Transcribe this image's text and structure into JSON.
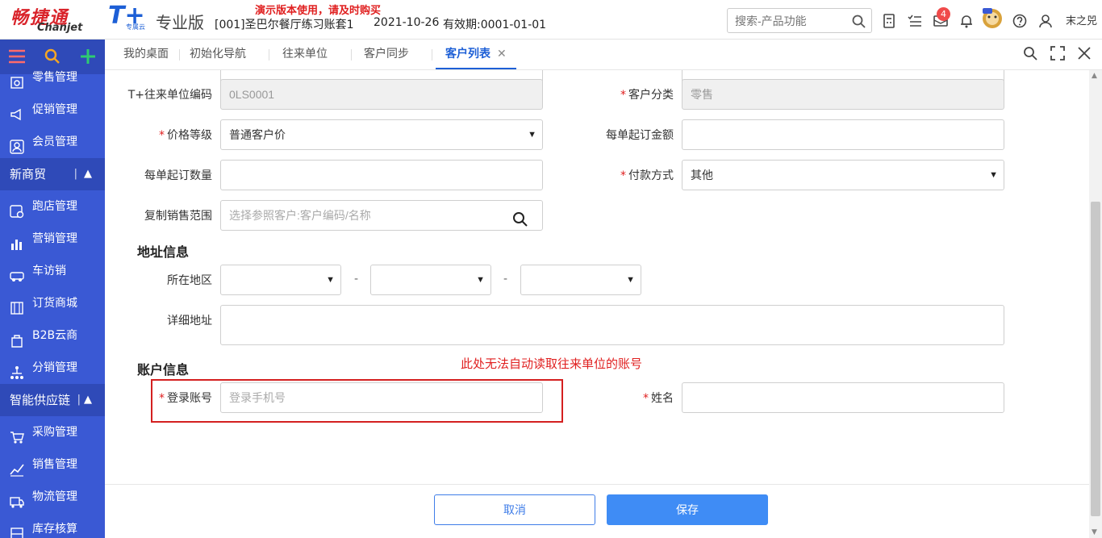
{
  "header": {
    "logo_cn": "畅捷通",
    "logo_en": "Chanjet",
    "product_logo": "T+",
    "product_sub": "专属云",
    "edition": "专业版",
    "demo_warning": "演示版本使用，请及时购买",
    "account": "[001]圣巴尔餐厅练习账套1",
    "date": "2021-10-26",
    "validity": "有效期:0001-01-01",
    "search_placeholder": "搜索-产品功能",
    "notification_count": "4",
    "user_name": "末之兕"
  },
  "sidebar": {
    "items_top": [
      {
        "label": "零售管理",
        "icon": "retail-icon"
      },
      {
        "label": "促销管理",
        "icon": "promotion-icon"
      },
      {
        "label": "会员管理",
        "icon": "member-icon"
      }
    ],
    "group1": "新商贸",
    "items_mid": [
      {
        "label": "跑店管理",
        "icon": "store-visit-icon"
      },
      {
        "label": "营销管理",
        "icon": "marketing-icon"
      },
      {
        "label": "车访销",
        "icon": "car-sales-icon"
      },
      {
        "label": "订货商城",
        "icon": "order-mall-icon"
      },
      {
        "label": "B2B云商",
        "icon": "b2b-icon"
      },
      {
        "label": "分销管理",
        "icon": "distribution-icon"
      }
    ],
    "group2": "智能供应链",
    "items_bottom": [
      {
        "label": "采购管理",
        "icon": "purchase-icon"
      },
      {
        "label": "销售管理",
        "icon": "sales-icon"
      },
      {
        "label": "物流管理",
        "icon": "logistics-icon"
      },
      {
        "label": "库存核算",
        "icon": "inventory-icon"
      }
    ]
  },
  "tabs": [
    {
      "label": "我的桌面"
    },
    {
      "label": "初始化导航"
    },
    {
      "label": "往来单位"
    },
    {
      "label": "客户同步"
    },
    {
      "label": "客户列表"
    }
  ],
  "form": {
    "partner_code_label": "T+往来单位编码",
    "partner_code_value": "0LS0001",
    "customer_class_label": "客户分类",
    "customer_class_value": "零售",
    "price_level_label": "价格等级",
    "price_level_value": "普通客户价",
    "min_order_amount_label": "每单起订金额",
    "min_order_amount_value": "",
    "min_order_qty_label": "每单起订数量",
    "min_order_qty_value": "",
    "payment_method_label": "付款方式",
    "payment_method_value": "其他",
    "copy_range_label": "复制销售范围",
    "copy_range_placeholder": "选择参照客户:客户编码/名称",
    "address_section": "地址信息",
    "region_label": "所在地区",
    "dash": "-",
    "detail_address_label": "详细地址",
    "account_section": "账户信息",
    "annotation": "此处无法自动读取往来单位的账号",
    "login_label": "登录账号",
    "login_placeholder": "登录手机号",
    "name_label": "姓名",
    "name_value": "",
    "required_mark": "*"
  },
  "footer": {
    "cancel": "取消",
    "save": "保存"
  },
  "colors": {
    "sidebar": "#3a59d4",
    "sidebar_dark": "#2f4ab8",
    "primary": "#3f8cf5",
    "required": "#e02020"
  }
}
